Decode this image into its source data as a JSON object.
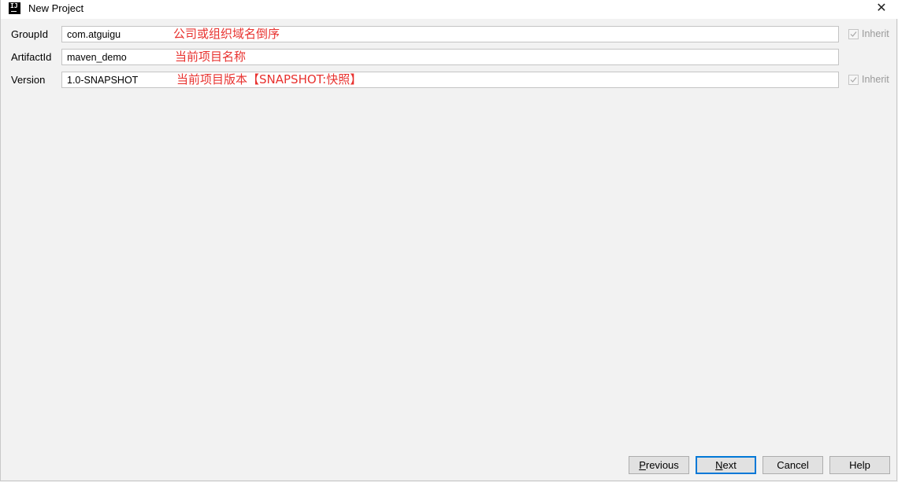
{
  "window": {
    "title": "New Project"
  },
  "fields": [
    {
      "label": "GroupId",
      "value": "com.atguigu",
      "annotation": "公司或组织域名倒序",
      "inherit_label": "Inherit",
      "inherit_checked": true
    },
    {
      "label": "ArtifactId",
      "value": "maven_demo",
      "annotation": "当前项目名称"
    },
    {
      "label": "Version",
      "value": "1.0-SNAPSHOT",
      "annotation": "当前项目版本【SNAPSHOT:快照】",
      "inherit_label": "Inherit",
      "inherit_checked": true
    }
  ],
  "buttons": {
    "previous": {
      "mnemonic": "P",
      "rest": "revious"
    },
    "next": {
      "mnemonic": "N",
      "rest": "ext"
    },
    "cancel": "Cancel",
    "help": "Help"
  },
  "colors": {
    "annotation": "#e8322f",
    "default_button_border": "#0078d7"
  }
}
